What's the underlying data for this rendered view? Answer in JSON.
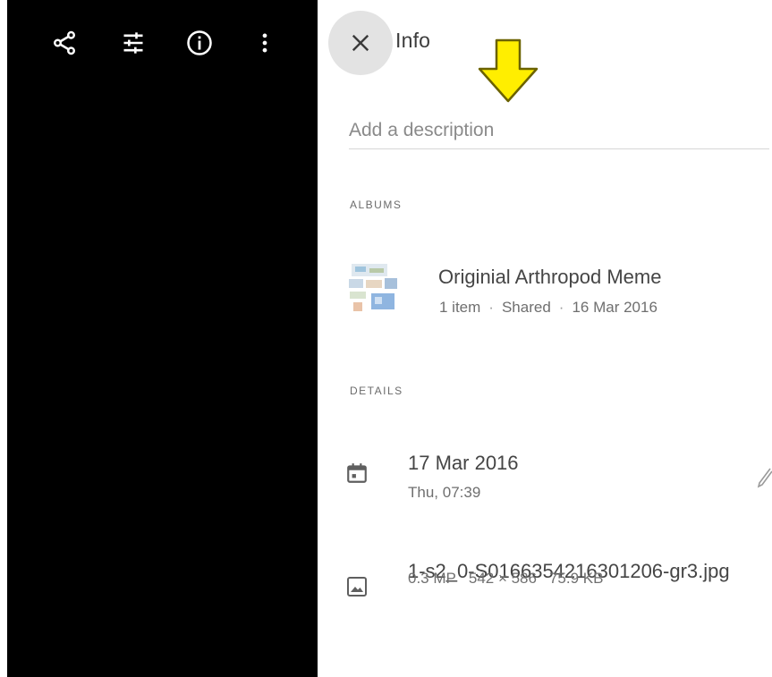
{
  "toolbar": {
    "share_icon": "share-icon",
    "adjust_icon": "tune-icon",
    "info_icon": "info-icon",
    "more_icon": "more-vert-icon"
  },
  "panel": {
    "title": "Info",
    "close_icon": "close-icon",
    "description_placeholder": "Add a description"
  },
  "albums": {
    "section_label": "ALBUMS",
    "items": [
      {
        "name": "Originial Arthropod Meme",
        "count": "1 item",
        "status": "Shared",
        "date": "16 Mar 2016"
      }
    ]
  },
  "details": {
    "section_label": "DETAILS",
    "date": {
      "icon": "calendar-icon",
      "date": "17 Mar 2016",
      "time": "Thu, 07:39",
      "edit_icon": "edit-pencil-icon"
    },
    "file": {
      "icon": "image-icon",
      "filename": "1-s2_0-S0166354216301206-gr3.jpg",
      "megapixels": "0.3 MP",
      "dimensions": "542 × 586",
      "size": "75.9 KB"
    }
  },
  "colors": {
    "viewer_bg": "#000000",
    "annotation_arrow": "#ffee00",
    "close_button_bg": "#e3e3e3"
  }
}
